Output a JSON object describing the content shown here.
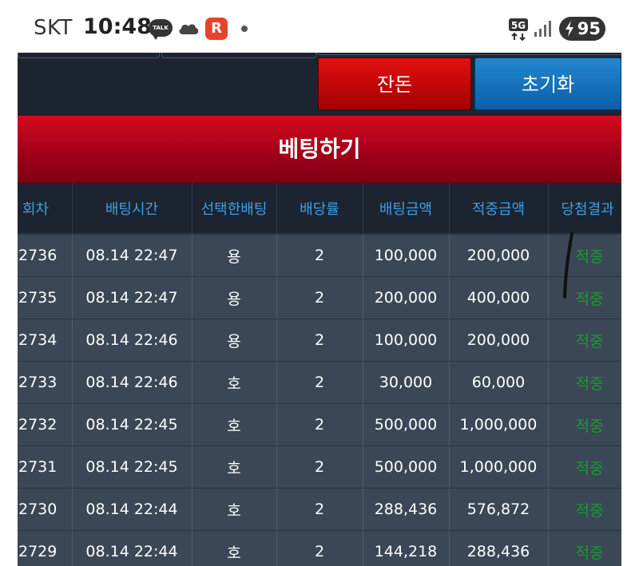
{
  "status_bar": {
    "carrier": "SKT",
    "time": "10:48",
    "talk_badge": "TALK",
    "app_badge": "R",
    "network": "5G",
    "battery": "95"
  },
  "toolbar": {
    "balance_label": "잔돈",
    "reset_label": "초기화"
  },
  "banner": {
    "title": "베팅하기"
  },
  "table": {
    "columns": [
      "회차",
      "배팅시간",
      "선택한배팅",
      "배당률",
      "배팅금액",
      "적중금액",
      "당첨결과"
    ],
    "rows": [
      {
        "round": "2736",
        "time": "08.14 22:47",
        "pick": "용",
        "odds": "2",
        "bet": "100,000",
        "win": "200,000",
        "result": "적중"
      },
      {
        "round": "2735",
        "time": "08.14 22:47",
        "pick": "용",
        "odds": "2",
        "bet": "200,000",
        "win": "400,000",
        "result": "적중"
      },
      {
        "round": "2734",
        "time": "08.14 22:46",
        "pick": "용",
        "odds": "2",
        "bet": "100,000",
        "win": "200,000",
        "result": "적중"
      },
      {
        "round": "2733",
        "time": "08.14 22:46",
        "pick": "호",
        "odds": "2",
        "bet": "30,000",
        "win": "60,000",
        "result": "적중"
      },
      {
        "round": "2732",
        "time": "08.14 22:45",
        "pick": "호",
        "odds": "2",
        "bet": "500,000",
        "win": "1,000,000",
        "result": "적중"
      },
      {
        "round": "2731",
        "time": "08.14 22:45",
        "pick": "호",
        "odds": "2",
        "bet": "500,000",
        "win": "1,000,000",
        "result": "적중"
      },
      {
        "round": "2730",
        "time": "08.14 22:44",
        "pick": "호",
        "odds": "2",
        "bet": "288,436",
        "win": "576,872",
        "result": "적중"
      },
      {
        "round": "2729",
        "time": "08.14 22:44",
        "pick": "호",
        "odds": "2",
        "bet": "144,218",
        "win": "288,436",
        "result": "적중"
      }
    ]
  },
  "colors": {
    "header_text": "#3e9fe6",
    "result_text": "#1a9b2e",
    "banner_red": "#a2001a",
    "reset_blue": "#0a5fa8"
  },
  "icons": [
    "talk-icon",
    "cloud-icon",
    "app-r-icon",
    "notification-dot-icon",
    "data-5g-icon",
    "signal-icon",
    "battery-charging-icon"
  ]
}
